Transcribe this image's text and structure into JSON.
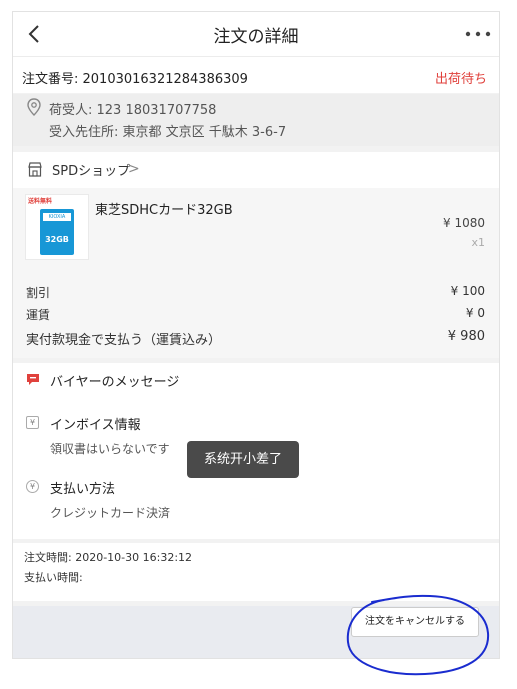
{
  "header": {
    "title": "注文の詳細"
  },
  "order": {
    "label": "注文番号: 201030163212843863​09",
    "status": "出荷待ち"
  },
  "address": {
    "recipient": "荷受人:   123  18031707758",
    "line": "受入先住所:  東京都 文京区 千駄木 3-6-7"
  },
  "shop": {
    "name": "SPDショップ",
    "chevron": ">"
  },
  "product": {
    "name": "東芝SDHCカード32GB",
    "price": "¥ 1080",
    "qty": "x1",
    "badge": "送料無料",
    "brand": "KIOXIA",
    "capacity": "32GB"
  },
  "summary": {
    "discount_label": "割引",
    "discount_value": "¥ 100",
    "shipping_label": "運賃",
    "shipping_value": "¥ 0",
    "paid_label": "実付款現金で支払う（運賃込み）",
    "paid_value": "¥ 980"
  },
  "sections": {
    "message_label": "バイヤーのメッセージ",
    "invoice_label": "インボイス情報",
    "invoice_sub": "領収書はいらないです",
    "payment_label": "支払い方法",
    "payment_sub": "クレジットカード決済"
  },
  "toast": "系统开小差了",
  "times": {
    "order_time": "注文時間:  2020-10-30 16:32:12",
    "pay_time": "支払い時間:"
  },
  "footer": {
    "cancel_label": "注文をキャンセルする"
  },
  "colors": {
    "status": "#e0413c",
    "toast_bg": "#4a4a4a",
    "annotation": "#1a2ccf"
  },
  "icons": [
    "back-icon",
    "more-icon",
    "location-pin-icon",
    "shop-icon",
    "message-icon",
    "invoice-icon",
    "payment-icon"
  ]
}
